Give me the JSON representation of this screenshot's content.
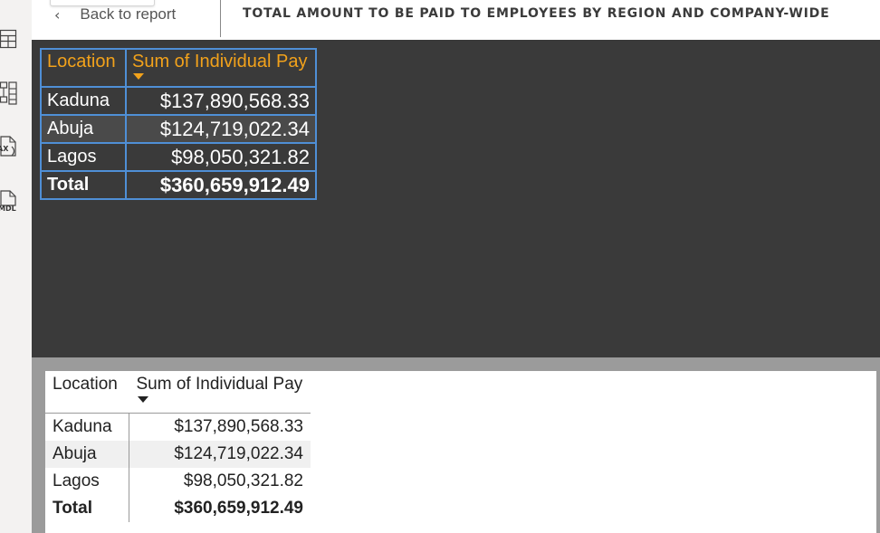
{
  "header": {
    "back_label": "Back to report",
    "back_icon": "chevron-left-icon",
    "title": "TOTAL AMOUNT TO BE PAID TO EMPLOYEES BY REGION AND COMPANY-WIDE"
  },
  "rail": {
    "icons": [
      "table-view-icon",
      "model-tree-icon",
      "dax-query-icon",
      "tmdl-view-icon"
    ],
    "dax_caption": "AX",
    "tmdl_caption": "MDL"
  },
  "colors": {
    "dark_canvas": "#3a3a3a",
    "header_accent": "#f2a21b",
    "grid_border": "#4f8fd6",
    "gray_band": "#9b9b9b"
  },
  "dark_table": {
    "headers": [
      "Location",
      "Sum of Individual Pay"
    ],
    "rows": [
      {
        "location": "Kaduna",
        "pay": "$137,890,568.33"
      },
      {
        "location": "Abuja",
        "pay": "$124,719,022.34"
      },
      {
        "location": "Lagos",
        "pay": "$98,050,321.82"
      }
    ],
    "total": {
      "location": "Total",
      "pay": "$360,659,912.49"
    }
  },
  "light_table": {
    "headers": [
      "Location",
      "Sum of Individual Pay"
    ],
    "rows": [
      {
        "location": "Kaduna",
        "pay": "$137,890,568.33"
      },
      {
        "location": "Abuja",
        "pay": "$124,719,022.34"
      },
      {
        "location": "Lagos",
        "pay": "$98,050,321.82"
      }
    ],
    "total": {
      "location": "Total",
      "pay": "$360,659,912.49"
    }
  }
}
